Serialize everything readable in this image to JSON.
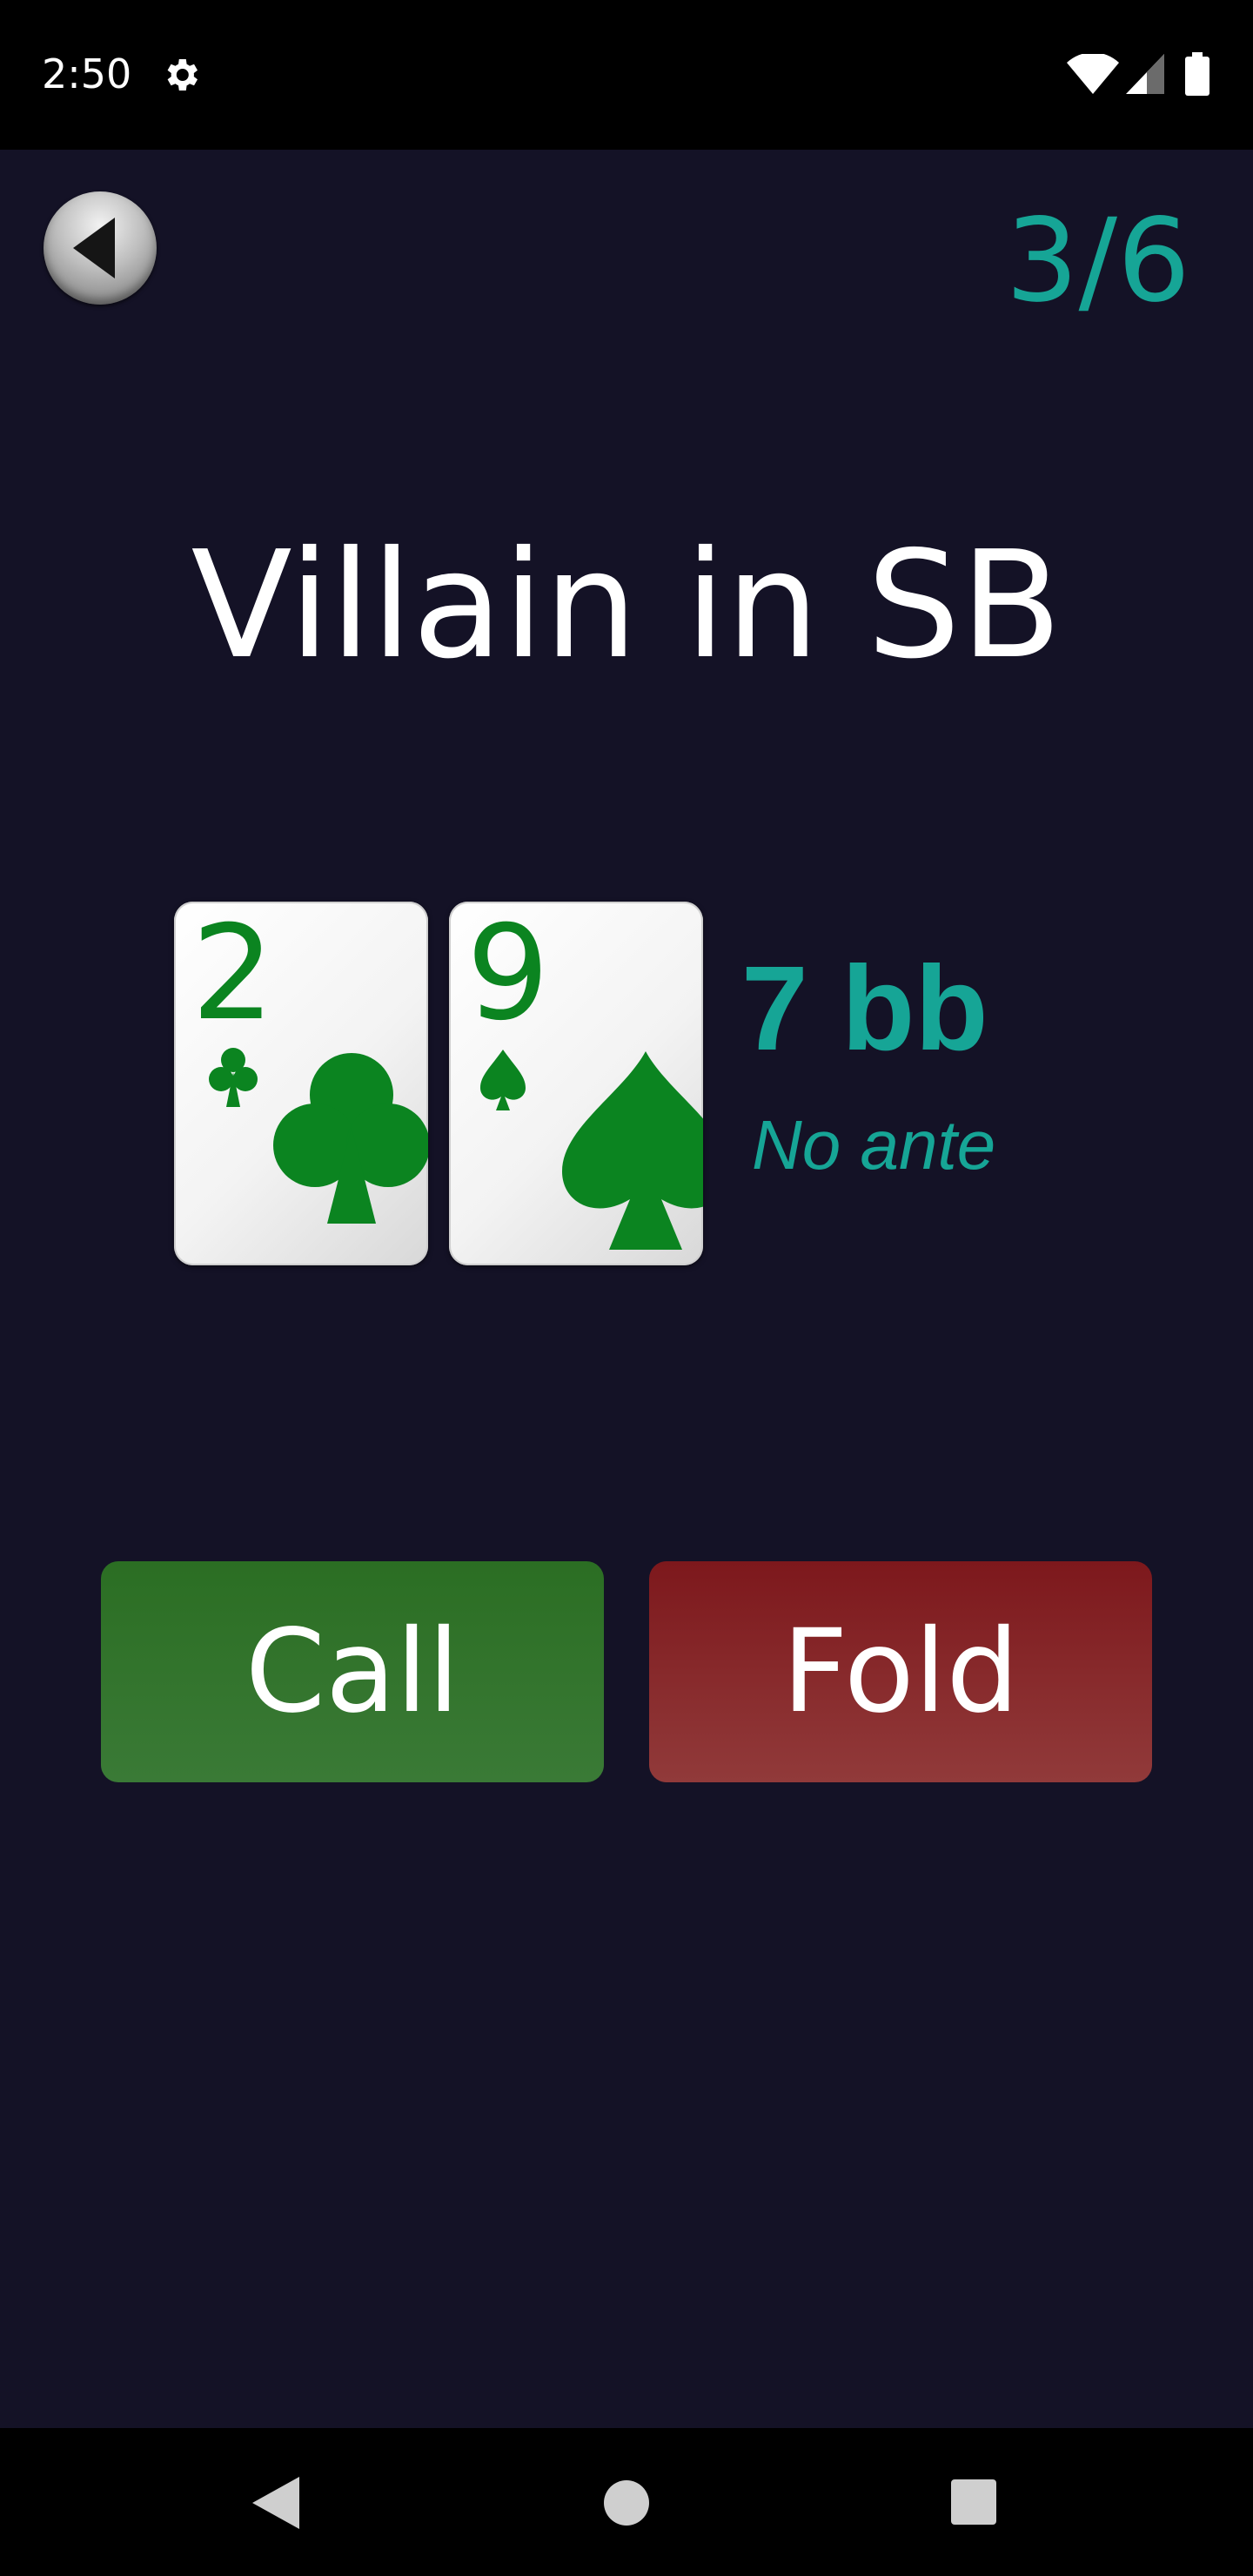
{
  "status_bar": {
    "time": "2:50",
    "icons": [
      "gear-icon",
      "wifi-icon",
      "signal-icon",
      "battery-icon"
    ]
  },
  "header": {
    "back_icon": "back-arrow-icon",
    "progress": "3/6"
  },
  "scenario": {
    "title": "Villain in SB",
    "cards": [
      {
        "rank": "2",
        "suit": "clubs"
      },
      {
        "rank": "9",
        "suit": "spades"
      }
    ],
    "stack": "7 bb",
    "ante": "No ante"
  },
  "actions": {
    "call_label": "Call",
    "fold_label": "Fold"
  },
  "nav_bar": {
    "icons": [
      "back-triangle-icon",
      "home-circle-icon",
      "recents-square-icon"
    ]
  },
  "colors": {
    "background": "#141226",
    "accent": "#16a596",
    "card_suit": "#0b8420",
    "call": "#2f722a",
    "fold": "#862a2c"
  }
}
